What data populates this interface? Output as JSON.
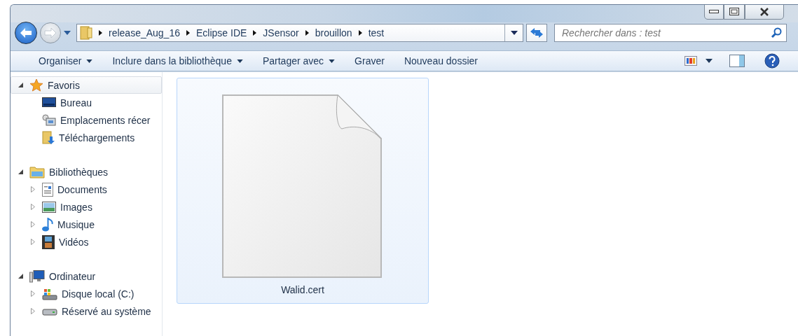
{
  "breadcrumb": [
    "release_Aug_16",
    "Eclipse IDE",
    "JSensor",
    "brouillon",
    "test"
  ],
  "search": {
    "placeholder": "Rechercher dans : test"
  },
  "toolbar": [
    {
      "label": "Organiser",
      "dropdown": true
    },
    {
      "label": "Inclure dans la bibliothèque",
      "dropdown": true
    },
    {
      "label": "Partager avec",
      "dropdown": true
    },
    {
      "label": "Graver",
      "dropdown": false
    },
    {
      "label": "Nouveau dossier",
      "dropdown": false
    }
  ],
  "sidebar": {
    "groups": [
      {
        "label": "Favoris",
        "kind": "star",
        "expanded": true,
        "selected": true,
        "children": [
          {
            "label": "Bureau",
            "kind": "desktop",
            "has_children": false
          },
          {
            "label": "Emplacements récer",
            "kind": "recent",
            "has_children": false
          },
          {
            "label": "Téléchargements",
            "kind": "download",
            "has_children": false
          }
        ]
      },
      {
        "label": "Bibliothèques",
        "kind": "library",
        "expanded": true,
        "selected": false,
        "children": [
          {
            "label": "Documents",
            "kind": "document",
            "has_children": true
          },
          {
            "label": "Images",
            "kind": "image",
            "has_children": true
          },
          {
            "label": "Musique",
            "kind": "music",
            "has_children": true
          },
          {
            "label": "Vidéos",
            "kind": "video",
            "has_children": true
          }
        ]
      },
      {
        "label": "Ordinateur",
        "kind": "computer",
        "expanded": true,
        "selected": false,
        "children": [
          {
            "label": "Disque local (C:)",
            "kind": "disk",
            "has_children": true
          },
          {
            "label": "Réservé au système",
            "kind": "drive",
            "has_children": true
          }
        ]
      }
    ]
  },
  "files": [
    {
      "name": "Walid.cert",
      "selected": true
    }
  ]
}
